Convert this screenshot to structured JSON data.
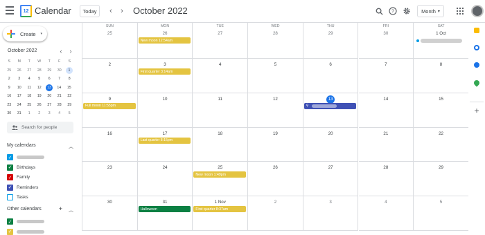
{
  "app": {
    "title": "Calendar",
    "logo_text": "12"
  },
  "header": {
    "today_label": "Today",
    "prev": "‹",
    "next": "›",
    "month_title": "October 2022",
    "view_label": "Month",
    "view_caret": "▾"
  },
  "sidebar": {
    "create_label": "Create",
    "create_caret": "▾",
    "mini_title": "October 2022",
    "mini_prev": "‹",
    "mini_next": "›",
    "weekday_headers": [
      "S",
      "M",
      "T",
      "W",
      "T",
      "F",
      "S"
    ],
    "search_people_placeholder": "Search for people",
    "my_calendars_title": "My calendars",
    "my_calendars": [
      {
        "name": "",
        "color": "#039be5",
        "checked": true
      },
      {
        "name": "Birthdays",
        "color": "#0b8043",
        "checked": true
      },
      {
        "name": "Family",
        "color": "#d50000",
        "checked": true
      },
      {
        "name": "Reminders",
        "color": "#3f51b5",
        "checked": true
      },
      {
        "name": "Tasks",
        "color": "#039be5",
        "checked": false
      }
    ],
    "other_calendars_title": "Other calendars",
    "other_calendars": [
      {
        "name": "",
        "color": "#0b8043",
        "checked": true
      },
      {
        "name": "",
        "color": "#e4c441",
        "checked": true
      }
    ]
  },
  "mini_calendar": [
    [
      {
        "d": "25",
        "dim": true
      },
      {
        "d": "26",
        "dim": true
      },
      {
        "d": "27",
        "dim": true
      },
      {
        "d": "28",
        "dim": true
      },
      {
        "d": "29",
        "dim": true
      },
      {
        "d": "30",
        "dim": true
      },
      {
        "d": "1",
        "sel": true
      }
    ],
    [
      {
        "d": "2"
      },
      {
        "d": "3"
      },
      {
        "d": "4"
      },
      {
        "d": "5"
      },
      {
        "d": "6"
      },
      {
        "d": "7"
      },
      {
        "d": "8"
      }
    ],
    [
      {
        "d": "9"
      },
      {
        "d": "10"
      },
      {
        "d": "11"
      },
      {
        "d": "12"
      },
      {
        "d": "13",
        "today": true
      },
      {
        "d": "14"
      },
      {
        "d": "15"
      }
    ],
    [
      {
        "d": "16"
      },
      {
        "d": "17"
      },
      {
        "d": "18"
      },
      {
        "d": "19"
      },
      {
        "d": "20"
      },
      {
        "d": "21"
      },
      {
        "d": "22"
      }
    ],
    [
      {
        "d": "23"
      },
      {
        "d": "24"
      },
      {
        "d": "25"
      },
      {
        "d": "26"
      },
      {
        "d": "27"
      },
      {
        "d": "28"
      },
      {
        "d": "29"
      }
    ],
    [
      {
        "d": "30"
      },
      {
        "d": "31"
      },
      {
        "d": "1",
        "dim": true
      },
      {
        "d": "2",
        "dim": true
      },
      {
        "d": "3",
        "dim": true
      },
      {
        "d": "4",
        "dim": true
      },
      {
        "d": "5",
        "dim": true
      }
    ]
  ],
  "weekday_labels": [
    "SUN",
    "MON",
    "TUE",
    "WED",
    "THU",
    "FRI",
    "SAT"
  ],
  "weeks": [
    [
      "25",
      "26",
      "27",
      "28",
      "29",
      "30",
      "1 Oct"
    ],
    [
      "2",
      "3",
      "4",
      "5",
      "6",
      "7",
      "8"
    ],
    [
      "9",
      "10",
      "11",
      "12",
      "13",
      "14",
      "15"
    ],
    [
      "16",
      "17",
      "18",
      "19",
      "20",
      "21",
      "22"
    ],
    [
      "23",
      "24",
      "25",
      "26",
      "27",
      "28",
      "29"
    ],
    [
      "30",
      "31",
      "1 Nov",
      "2",
      "3",
      "4",
      "5"
    ]
  ],
  "dim_days": [
    [
      0,
      0
    ],
    [
      0,
      1
    ],
    [
      0,
      2
    ],
    [
      0,
      3
    ],
    [
      0,
      4
    ],
    [
      0,
      5
    ],
    [
      5,
      3
    ],
    [
      5,
      4
    ],
    [
      5,
      5
    ],
    [
      5,
      6
    ]
  ],
  "today_cell": [
    2,
    4
  ],
  "events": [
    {
      "week": 0,
      "day": 1,
      "label": "New moon 12:54am",
      "color": "#e4c441"
    },
    {
      "week": 1,
      "day": 1,
      "label": "First quarter 3:14am",
      "color": "#e4c441"
    },
    {
      "week": 2,
      "day": 0,
      "label": "Full moon 11:55pm",
      "color": "#e4c441"
    },
    {
      "week": 2,
      "day": 4,
      "label": "",
      "color": "#3f51b5",
      "blurred": true
    },
    {
      "week": 3,
      "day": 1,
      "label": "Last quarter 8:15pm",
      "color": "#e4c441"
    },
    {
      "week": 4,
      "day": 2,
      "label": "New moon 1:49pm",
      "color": "#e4c441"
    },
    {
      "week": 5,
      "day": 1,
      "label": "Halloween",
      "color": "#0b8043"
    },
    {
      "week": 5,
      "day": 2,
      "label": "First quarter 8:37am",
      "color": "#e4c441"
    }
  ],
  "sat_event_dot": {
    "week": 0,
    "day": 6,
    "color": "#039be5"
  }
}
